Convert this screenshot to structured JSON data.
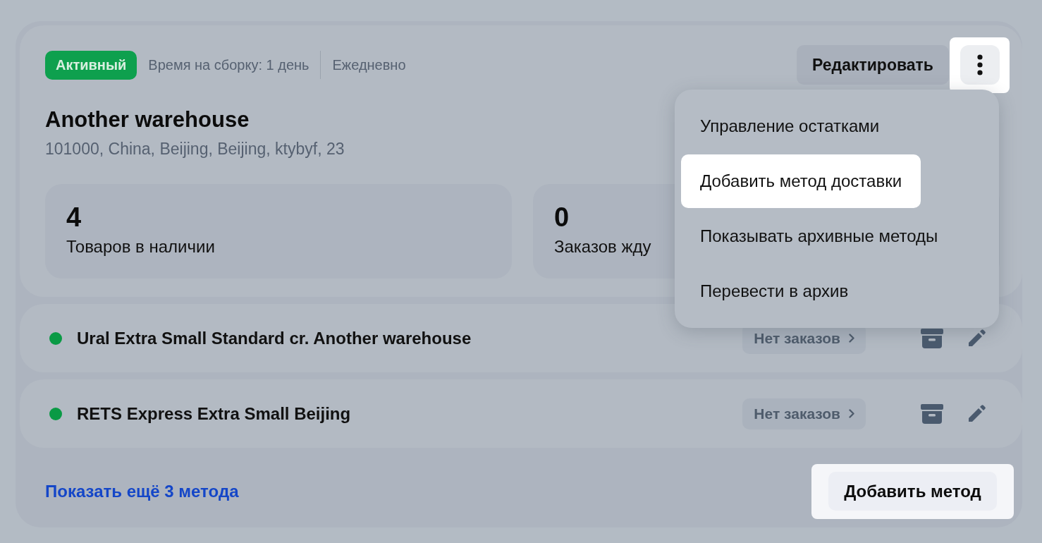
{
  "card": {
    "status": {
      "label": "Активный",
      "kind": "active"
    },
    "meta": [
      "Время на сборку: 1 день",
      "Ежедневно"
    ],
    "edit_button": "Редактировать",
    "more_button": {
      "highlighted": true
    },
    "title": "Another warehouse",
    "address": "101000, China, Beijing, Beijing, ktybyf, 23",
    "stats": [
      {
        "value": "4",
        "label": "Товаров в наличии"
      },
      {
        "value": "0",
        "label": "Заказов жду"
      }
    ]
  },
  "menu": {
    "items": [
      {
        "label": "Управление остатками",
        "highlighted": false
      },
      {
        "label": "Добавить метод доставки",
        "highlighted": true
      },
      {
        "label": "Показывать архивные методы",
        "highlighted": false
      },
      {
        "label": "Перевести в архив",
        "highlighted": false
      }
    ]
  },
  "methods": [
    {
      "name": "Ural Extra Small Standard cr. Another warehouse",
      "color": "#0a9a45",
      "orders": "Нет заказов"
    },
    {
      "name": "RETS Express Extra Small Beijing",
      "color": "#0a9a45",
      "orders": "Нет заказов"
    }
  ],
  "footer": {
    "link": "Показать ещё 3 метода",
    "add_button": {
      "label": "Добавить метод",
      "highlighted": true
    }
  }
}
